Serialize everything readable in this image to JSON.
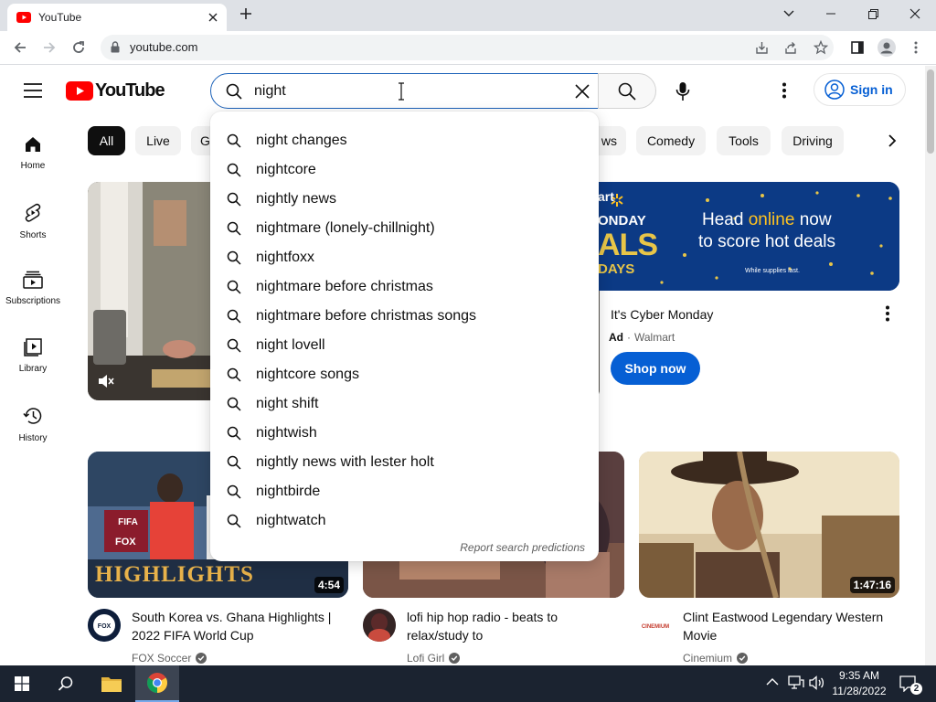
{
  "browser": {
    "tab_title": "YouTube",
    "url": "youtube.com",
    "tab_icon": "youtube-favicon",
    "colors": {
      "accent": "#1a73e8",
      "tabstrip": "#dee1e6"
    }
  },
  "youtube": {
    "logo_text": "YouTube",
    "brand_color": "#ff0000",
    "search": {
      "query": "night",
      "placeholder": "Search"
    },
    "signin_label": "Sign in",
    "sidebar": [
      {
        "label": "Home",
        "icon": "home-icon"
      },
      {
        "label": "Shorts",
        "icon": "shorts-icon"
      },
      {
        "label": "Subscriptions",
        "icon": "subscriptions-icon"
      },
      {
        "label": "Library",
        "icon": "library-icon"
      },
      {
        "label": "History",
        "icon": "history-icon"
      }
    ],
    "chips": [
      "All",
      "Live",
      "G",
      "ws",
      "Comedy",
      "Tools",
      "Driving"
    ],
    "ad": {
      "title": "It's Cyber Monday",
      "badge": "Ad",
      "advertiser": "Walmart",
      "cta": "Shop now",
      "banner_head": "Head online now",
      "banner_sub": "to score hot deals",
      "banner_small": "While supplies last.",
      "banner_left_1": "art",
      "banner_left_2": "ONDAY",
      "banner_left_3": "ALS",
      "banner_left_4": "DAYS"
    },
    "videos": [
      {
        "title": "South Korea vs. Ghana Highlights | 2022 FIFA World Cup",
        "channel": "FOX Soccer",
        "duration": "4:54",
        "thumb_text": "HIGHLIGHTS"
      },
      {
        "title": "lofi hip hop radio - beats to relax/study to",
        "channel": "Lofi Girl",
        "duration": ""
      },
      {
        "title": "Clint Eastwood Legendary Western Movie",
        "channel": "Cinemium",
        "duration": "1:47:16"
      }
    ],
    "suggestions": [
      {
        "prefix": "night",
        "suffix": " changes"
      },
      {
        "prefix": "night",
        "suffix": "core"
      },
      {
        "prefix": "night",
        "suffix": "ly news"
      },
      {
        "prefix": "night",
        "suffix": "mare (lonely-chillnight)"
      },
      {
        "prefix": "night",
        "suffix": "foxx"
      },
      {
        "prefix": "night",
        "suffix": "mare before christmas"
      },
      {
        "prefix": "night",
        "suffix": "mare before christmas songs"
      },
      {
        "prefix": "night",
        "suffix": " lovell"
      },
      {
        "prefix": "night",
        "suffix": "core songs"
      },
      {
        "prefix": "night",
        "suffix": " shift"
      },
      {
        "prefix": "night",
        "suffix": "wish"
      },
      {
        "prefix": "night",
        "suffix": "ly news with lester holt"
      },
      {
        "prefix": "night",
        "suffix": "birde"
      },
      {
        "prefix": "night",
        "suffix": "watch"
      }
    ],
    "report_label": "Report search predictions"
  },
  "taskbar": {
    "time": "9:35 AM",
    "date": "11/28/2022",
    "notification_count": "2"
  }
}
